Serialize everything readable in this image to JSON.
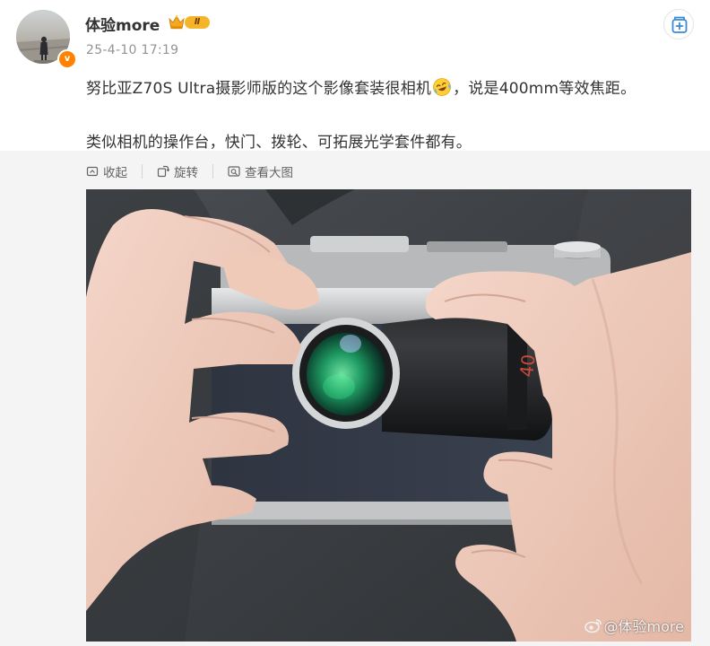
{
  "post": {
    "username": "体验more",
    "level_badge": "Ⅱ",
    "verified_badge": "v",
    "timestamp": "25-4-10 17:19",
    "text_line1_a": "努比亚Z70S Ultra摄影师版的这个影像套装很相机",
    "text_line1_b": "，说是400mm等效焦距。",
    "text_line2": "类似相机的操作台，快门、拨轮、可拓展光学套件都有。"
  },
  "toolbar": {
    "collapse_label": "收起",
    "rotate_label": "旋转",
    "view_large_label": "查看大图"
  },
  "image": {
    "watermark": "@体验more"
  },
  "colors": {
    "accent": "#ff8200",
    "follow_icon": "#3a8ad8",
    "muted_text": "#939393",
    "panel_bg": "#f4f4f4"
  },
  "icons": {
    "follow": "add-follow-icon",
    "crown": "crown-icon",
    "emoji": "laugh-cry-emoji-icon",
    "collapse": "collapse-icon",
    "rotate": "rotate-icon",
    "view_large": "view-large-icon",
    "weibo": "weibo-logo-icon"
  }
}
